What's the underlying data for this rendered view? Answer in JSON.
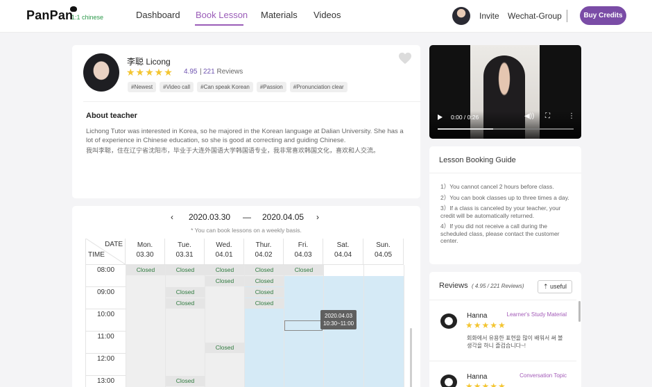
{
  "header": {
    "logo": "PanPan",
    "logo_sub": "1:1 chinese",
    "nav": [
      "Dashboard",
      "Book Lesson",
      "Materials",
      "Videos"
    ],
    "invite": "Invite",
    "wechat": "Wechat-Group",
    "buy": "Buy Credits"
  },
  "teacher": {
    "name": "李聪 Licong",
    "stars": "★★★★★",
    "rating": "4.95",
    "reviews_count": "221",
    "reviews_label": "Reviews",
    "tags": [
      "#Newest",
      "#Video call",
      "#Can speak Korean",
      "#Passion",
      "#Pronunciation clear"
    ],
    "about_title": "About teacher",
    "about_en": "Lichong Tutor was interested in Korea, so he majored in the Korean language at Dalian University. She has a lot of experience in Chinese education, so she is good at correcting and guiding Chinese.",
    "about_cn": "我叫李聪，住在辽宁省沈阳市，毕业于大连外国语大学韩国语专业，我非常喜欢韩国文化，喜欢和人交流。"
  },
  "schedule": {
    "prev": "‹",
    "next": "›",
    "start": "2020.03.30",
    "dash": "—",
    "end": "2020.04.05",
    "note": "* You can book lessons on a weekly basis.",
    "corner_date": "DATE",
    "corner_time": "TIME",
    "days": [
      {
        "day": "Mon.",
        "date": "03.30"
      },
      {
        "day": "Tue.",
        "date": "03.31"
      },
      {
        "day": "Wed.",
        "date": "04.01"
      },
      {
        "day": "Thur.",
        "date": "04.02"
      },
      {
        "day": "Fri.",
        "date": "04.03"
      },
      {
        "day": "Sat.",
        "date": "04.04"
      },
      {
        "day": "Sun.",
        "date": "04.05"
      }
    ],
    "times": [
      "08:00",
      "09:00",
      "10:00",
      "11:00",
      "12:00",
      "13:00"
    ],
    "closed_label": "Closed",
    "tooltip_date": "2020.04.03",
    "tooltip_time": "10:30~11:00"
  },
  "video": {
    "time": "0:00 / 0:26"
  },
  "guide": {
    "title": "Lesson Booking Guide",
    "items": [
      "1）You cannot cancel 2 hours before class.",
      "2）You can book classes up to three times a day.",
      "3）If a class is canceled by your teacher, your credit will be automatically returned.",
      "4）If you did not receive a call during the scheduled class, please contact the customer center."
    ]
  },
  "reviews": {
    "title": "Reviews",
    "summary": "( 4.95 / 221 Reviews)",
    "useful": "useful",
    "items": [
      {
        "name": "Hanna",
        "tag": "Learner's Study Material",
        "stars": "★★★★★",
        "text": "회화에서 유용한 표현을 많이 배워서 써 볼 생각을 하니 즐겁습니다~!"
      },
      {
        "name": "Hanna",
        "tag": "Conversation Topic",
        "stars": "★★★★★",
        "text": ""
      }
    ]
  },
  "colors": {
    "accent": "#7a4ca6",
    "nav_active": "#9a5cb8",
    "closed_text": "#2f7a3f",
    "available_bg": "#d5eaf6",
    "star": "#f3c531"
  }
}
